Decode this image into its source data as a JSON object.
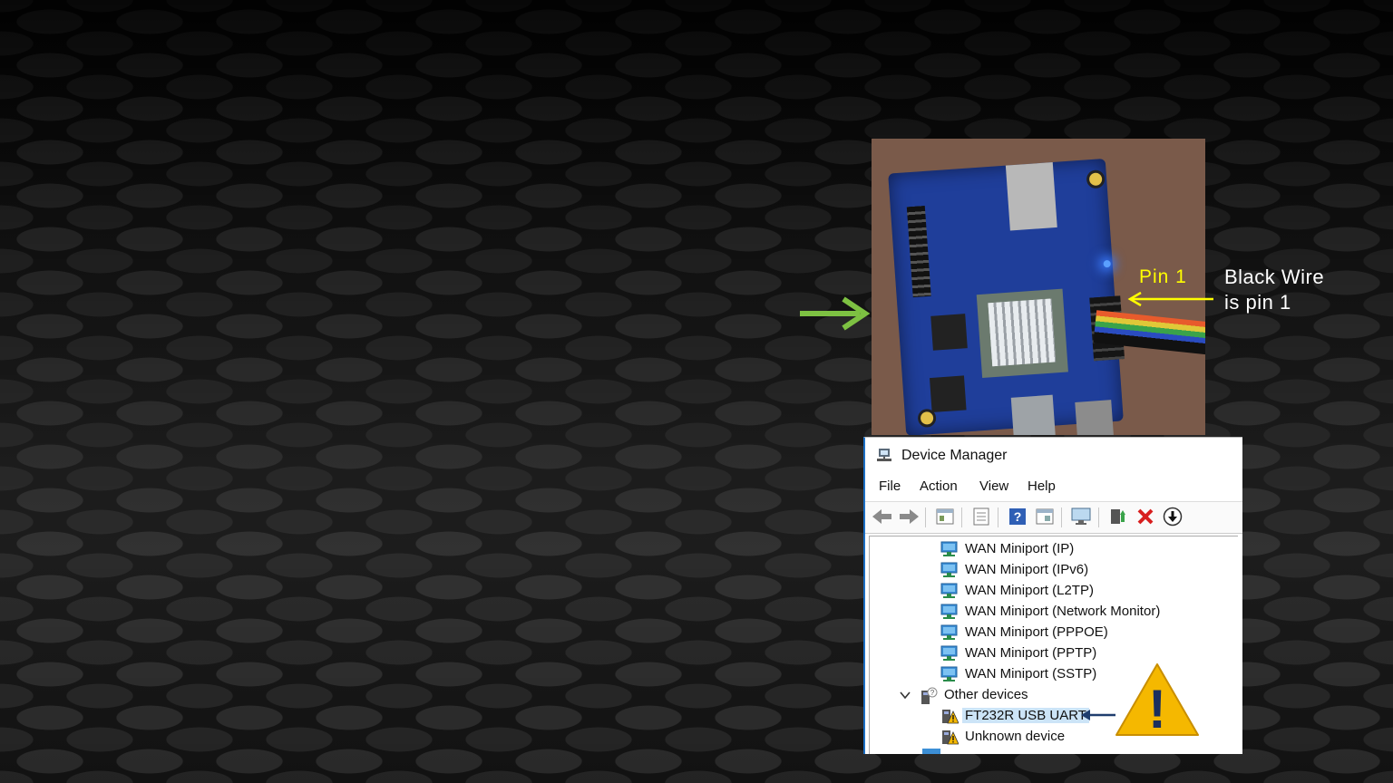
{
  "annotations": {
    "pin1_label": "Pin 1",
    "black_wire_line1": "Black Wire",
    "black_wire_line2": "is pin 1",
    "pin1_color": "#ffff00",
    "green_arrow_color": "#7dc142"
  },
  "device_manager": {
    "title": "Device Manager",
    "menu": [
      "File",
      "Action",
      "View",
      "Help"
    ],
    "toolbar_icons": [
      "back-icon",
      "forward-icon",
      "properties-icon",
      "details-icon",
      "help-icon",
      "view-icon",
      "monitor-icon",
      "update-driver-icon",
      "uninstall-icon",
      "download-icon"
    ],
    "tree": [
      {
        "label": "WAN Miniport (IP)",
        "icon": "network-adapter-icon"
      },
      {
        "label": "WAN Miniport (IPv6)",
        "icon": "network-adapter-icon"
      },
      {
        "label": "WAN Miniport (L2TP)",
        "icon": "network-adapter-icon"
      },
      {
        "label": "WAN Miniport (Network Monitor)",
        "icon": "network-adapter-icon"
      },
      {
        "label": "WAN Miniport (PPPOE)",
        "icon": "network-adapter-icon"
      },
      {
        "label": "WAN Miniport (PPTP)",
        "icon": "network-adapter-icon"
      },
      {
        "label": "WAN Miniport (SSTP)",
        "icon": "network-adapter-icon"
      },
      {
        "label": "Other devices",
        "icon": "unknown-device-category-icon"
      },
      {
        "label": "FT232R USB UART",
        "icon": "warning-device-icon"
      },
      {
        "label": "Unknown device",
        "icon": "warning-device-icon"
      }
    ],
    "warning_symbol": "!",
    "warning_color": "#f5b800"
  }
}
